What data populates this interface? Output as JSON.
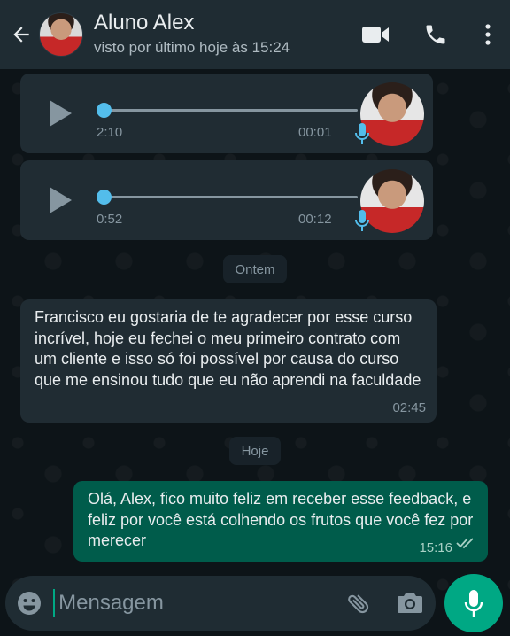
{
  "header": {
    "title": "Aluno Alex",
    "status": "visto por último hoje às 15:24"
  },
  "audio_messages": [
    {
      "duration": "2:10",
      "time": "00:01"
    },
    {
      "duration": "0:52",
      "time": "00:12"
    }
  ],
  "dates": {
    "yesterday": "Ontem",
    "today": "Hoje"
  },
  "incoming_message": {
    "text": "Francisco eu gostaria de te agradecer por esse curso incrível, hoje eu fechei o meu primeiro contrato com um cliente e isso só foi possível por causa do curso que me ensinou tudo que eu não aprendi na faculdade",
    "time": "02:45"
  },
  "outgoing_message": {
    "text": "Olá, Alex, fico muito feliz em receber esse feedback, e feliz por você está colhendo os frutos que você fez por merecer",
    "time": "15:16",
    "status_icon": "double-check-icon"
  },
  "composer": {
    "placeholder": "Mensagem"
  },
  "colors": {
    "header_bg": "#1f2c33",
    "incoming_bg": "#202c33",
    "outgoing_bg": "#005c4b",
    "accent": "#00a884",
    "audio_progress": "#53bdeb"
  },
  "icons": {
    "back": "arrow-left-icon",
    "video": "video-camera-icon",
    "call": "phone-icon",
    "menu": "more-vertical-icon",
    "play": "play-icon",
    "mic": "microphone-icon",
    "emoji": "emoji-icon",
    "attach": "paperclip-icon",
    "camera": "camera-icon"
  }
}
